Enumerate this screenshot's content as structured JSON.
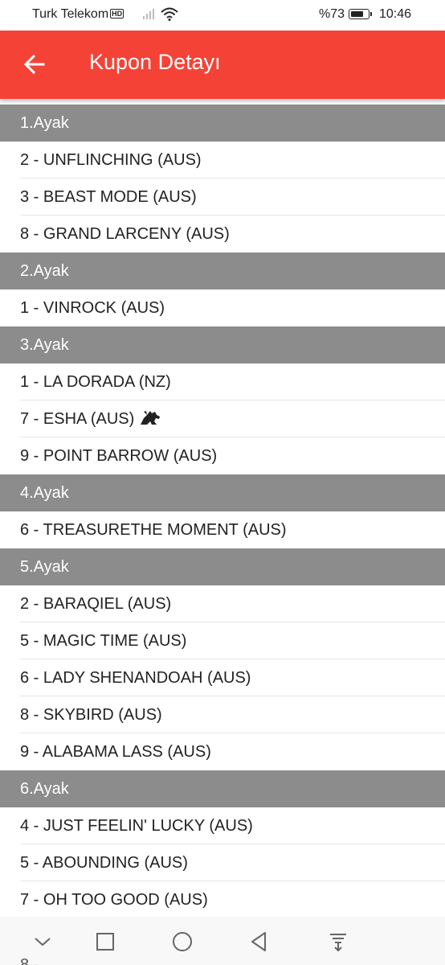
{
  "status_bar": {
    "carrier": "Turk Telekom",
    "hd_badge": "HD",
    "battery_text": "%73",
    "battery_level": 0.73,
    "time": "10:46"
  },
  "app_bar": {
    "title": "Kupon Detayı",
    "back_icon": "arrow-left-icon",
    "background": "#f44336"
  },
  "legs": [
    {
      "header": "1.Ayak",
      "runners": [
        "2 - UNFLINCHING (AUS)",
        "3 - BEAST MODE (AUS)",
        "8 - GRAND LARCENY (AUS)"
      ]
    },
    {
      "header": "2.Ayak",
      "runners": [
        "1 - VINROCK (AUS)"
      ]
    },
    {
      "header": "3.Ayak",
      "runners": [
        "1 - LA DORADA (NZ)",
        "7 - ESHA (AUS)",
        "9 - POINT BARROW (AUS)"
      ]
    },
    {
      "header": "4.Ayak",
      "runners": [
        "6 - TREASURETHE MOMENT (AUS)"
      ]
    },
    {
      "header": "5.Ayak",
      "runners": [
        "2 - BARAQIEL (AUS)",
        "5 - MAGIC TIME (AUS)",
        "6 - LADY SHENANDOAH (AUS)",
        "8 - SKYBIRD (AUS)",
        "9 - ALABAMA LASS (AUS)"
      ]
    },
    {
      "header": "6.Ayak",
      "runners": [
        "4 - JUST FEELIN' LUCKY (AUS)",
        "5 - ABOUNDING (AUS)",
        "7 - OH TOO GOOD (AUS)"
      ]
    }
  ],
  "nav_bar": {
    "buttons": [
      "chevron-down-icon",
      "square-icon",
      "circle-icon",
      "triangle-back-icon",
      "notification-pull-icon"
    ]
  }
}
